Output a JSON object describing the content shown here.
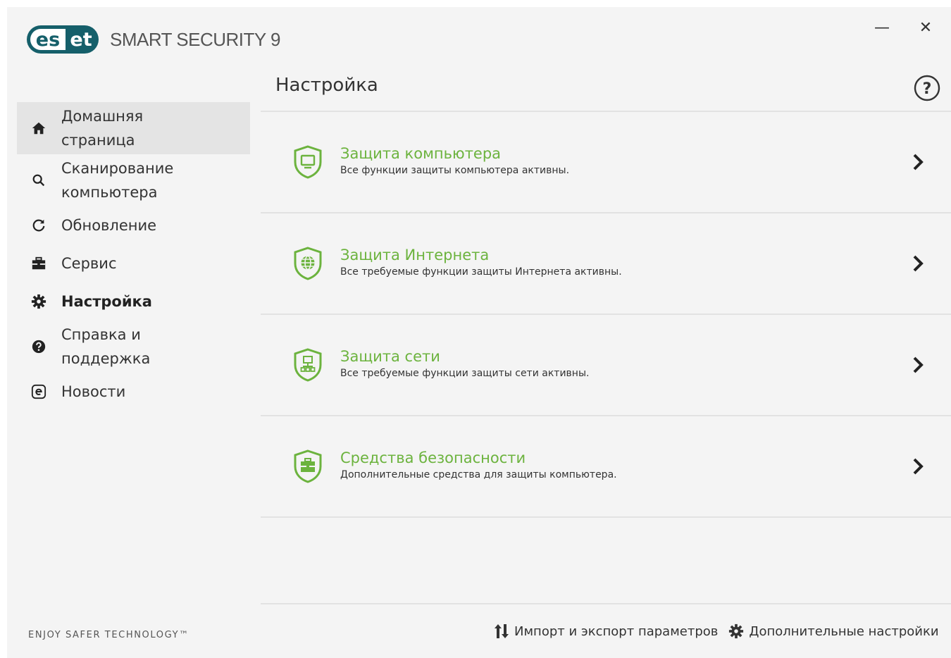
{
  "header": {
    "logo_left": "es",
    "logo_right": "et",
    "product_name": "SMART SECURITY 9",
    "minimize_glyph": "—",
    "close_glyph": "✕"
  },
  "sidebar": {
    "items": [
      {
        "label": "Домашняя\nстраница",
        "icon": "home-icon"
      },
      {
        "label": "Сканирование\nкомпьютера",
        "icon": "search-icon"
      },
      {
        "label": "Обновление",
        "icon": "refresh-icon"
      },
      {
        "label": "Сервис",
        "icon": "toolbox-icon"
      },
      {
        "label": "Настройка",
        "icon": "gear-icon"
      },
      {
        "label": "Справка и\nподдержка",
        "icon": "help-icon"
      },
      {
        "label": "Новости",
        "icon": "news-icon"
      }
    ],
    "tagline": "ENJOY SAFER TECHNOLOGY™"
  },
  "main": {
    "title": "Настройка",
    "help_glyph": "?",
    "sections": [
      {
        "title": "Защита компьютера",
        "desc": "Все функции защиты компьютера активны.",
        "icon": "computer-shield-icon"
      },
      {
        "title": "Защита Интернета",
        "desc": "Все требуемые функции защиты Интернета активны.",
        "icon": "globe-shield-icon"
      },
      {
        "title": "Защита сети",
        "desc": "Все требуемые функции защиты сети активны.",
        "icon": "network-shield-icon"
      },
      {
        "title": "Средства безопасности",
        "desc": "Дополнительные средства для защиты компьютера.",
        "icon": "toolbox-shield-icon"
      }
    ]
  },
  "footer": {
    "import_export": "Импорт и экспорт параметров",
    "advanced": "Дополнительные настройки"
  },
  "colors": {
    "accent_green": "#6cb33e",
    "brand_teal": "#155f6a"
  }
}
